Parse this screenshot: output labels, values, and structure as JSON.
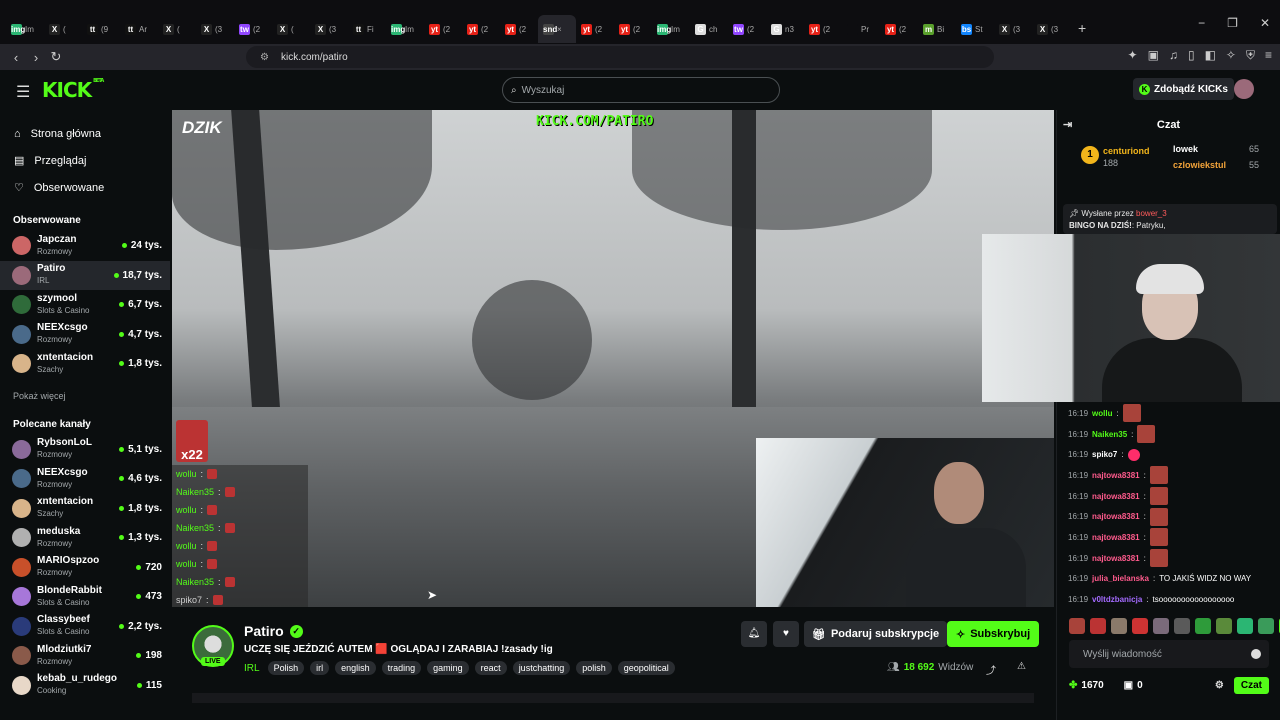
{
  "browser": {
    "tabs": [
      {
        "fav": "img",
        "label": "Im",
        "color": "#2bb673"
      },
      {
        "fav": "X",
        "label": "(",
        "color": "#222"
      },
      {
        "fav": "tt",
        "label": "(9",
        "color": "#111"
      },
      {
        "fav": "tt",
        "label": "Ar",
        "color": "#111"
      },
      {
        "fav": "X",
        "label": "(",
        "color": "#222"
      },
      {
        "fav": "X",
        "label": "(3",
        "color": "#222"
      },
      {
        "fav": "tw",
        "label": "(2",
        "color": "#9146ff"
      },
      {
        "fav": "X",
        "label": "(",
        "color": "#222"
      },
      {
        "fav": "X",
        "label": "(3",
        "color": "#222"
      },
      {
        "fav": "tt",
        "label": "Fi",
        "color": "#111"
      },
      {
        "fav": "img",
        "label": "Im",
        "color": "#2bb673"
      },
      {
        "fav": "yt",
        "label": "(2",
        "color": "#e62117"
      },
      {
        "fav": "yt",
        "label": "(2",
        "color": "#e62117"
      },
      {
        "fav": "yt",
        "label": "(2",
        "color": "#e62117"
      },
      {
        "fav": "snd",
        "label": "×",
        "color": "#444"
      },
      {
        "fav": "yt",
        "label": "(2",
        "color": "#e62117"
      },
      {
        "fav": "yt",
        "label": "(2",
        "color": "#e62117"
      },
      {
        "fav": "img",
        "label": "Im",
        "color": "#2bb673"
      },
      {
        "fav": "G",
        "label": "ch",
        "color": "#ddd"
      },
      {
        "fav": "tw",
        "label": "(2",
        "color": "#9146ff"
      },
      {
        "fav": "G",
        "label": "n3",
        "color": "#ddd"
      },
      {
        "fav": "yt",
        "label": "(2",
        "color": "#e62117"
      },
      {
        "fav": "",
        "label": "Pr",
        "color": "#0d0d10"
      },
      {
        "fav": "yt",
        "label": "(2",
        "color": "#e62117"
      },
      {
        "fav": "m",
        "label": "Bi",
        "color": "#5aa02c"
      },
      {
        "fav": "bs",
        "label": "St",
        "color": "#1185fe"
      },
      {
        "fav": "X",
        "label": "(3",
        "color": "#222"
      },
      {
        "fav": "X",
        "label": "(3",
        "color": "#222"
      }
    ],
    "url": "kick.com/patiro",
    "new_tab": "+",
    "win_min": "−",
    "win_max": "❐",
    "win_close": "✕"
  },
  "header": {
    "logo": "KICK",
    "logo_badge": "BETA",
    "search_placeholder": "Wyszukaj",
    "get_kicks": "Zdobądź KICKs"
  },
  "sidebar": {
    "nav": [
      {
        "icon": "home-icon",
        "glyph": "⌂",
        "label": "Strona główna"
      },
      {
        "icon": "browse-icon",
        "glyph": "▤",
        "label": "Przeglądaj"
      },
      {
        "icon": "heart-icon",
        "glyph": "♡",
        "label": "Obserwowane"
      }
    ],
    "followed_title": "Obserwowane",
    "followed": [
      {
        "name": "Japczan",
        "cat": "Rozmowy",
        "viewers": "24 tys.",
        "color": "#c66"
      },
      {
        "name": "Patiro",
        "cat": "IRL",
        "viewers": "18,7 tys.",
        "color": "#9b6a7a"
      },
      {
        "name": "szymool",
        "cat": "Slots & Casino",
        "viewers": "6,7 tys.",
        "color": "#2f6b3a"
      },
      {
        "name": "NEEXcsgo",
        "cat": "Rozmowy",
        "viewers": "4,7 tys.",
        "color": "#4a6a8a"
      },
      {
        "name": "xntentacion",
        "cat": "Szachy",
        "viewers": "1,8 tys.",
        "color": "#d8b48a"
      }
    ],
    "show_more": "Pokaż więcej",
    "recommended_title": "Polecane kanały",
    "recommended": [
      {
        "name": "RybsonLoL",
        "cat": "Rozmowy",
        "viewers": "5,1 tys.",
        "color": "#8a6a9a"
      },
      {
        "name": "NEEXcsgo",
        "cat": "Rozmowy",
        "viewers": "4,6 tys.",
        "color": "#4a6a8a"
      },
      {
        "name": "xntentacion",
        "cat": "Szachy",
        "viewers": "1,8 tys.",
        "color": "#d8b48a"
      },
      {
        "name": "meduska",
        "cat": "Rozmowy",
        "viewers": "1,3 tys.",
        "color": "#b0b0b0"
      },
      {
        "name": "MARIOspzoo",
        "cat": "Rozmowy",
        "viewers": "720",
        "color": "#c8502a"
      },
      {
        "name": "BlondeRabbit",
        "cat": "Slots & Casino",
        "viewers": "473",
        "color": "#a777d9"
      },
      {
        "name": "Classybeef",
        "cat": "Slots & Casino",
        "viewers": "2,2 tys.",
        "color": "#2a3b7a"
      },
      {
        "name": "Mlodziutki7",
        "cat": "Rozmowy",
        "viewers": "198",
        "color": "#8a5a4a"
      },
      {
        "name": "kebab_u_rudego",
        "cat": "Cooking",
        "viewers": "115",
        "color": "#e8d8c8"
      }
    ]
  },
  "video": {
    "overlay_brand": "DZIK",
    "watermark": "KICK.COM/PATIRO",
    "combo": "x22",
    "overlay_chat": [
      {
        "user": "wollu",
        "color": "#53fc18"
      },
      {
        "user": "Naiken35",
        "color": "#53fc18"
      },
      {
        "user": "wollu",
        "color": "#53fc18"
      },
      {
        "user": "Naiken35",
        "color": "#53fc18"
      },
      {
        "user": "wollu",
        "color": "#53fc18"
      },
      {
        "user": "wollu",
        "color": "#53fc18"
      },
      {
        "user": "Naiken35",
        "color": "#53fc18"
      },
      {
        "user": "spiko7",
        "color": "#cfcfcf"
      }
    ]
  },
  "stream": {
    "name": "Patiro",
    "live": "LIVE",
    "title": "UCZĘ SIĘ JEŹDZIĆ AUTEM 🟥 OGLĄDAJ I ZARABIAJ !zasady !ig",
    "category": "IRL",
    "tags": [
      "Polish",
      "irl",
      "english",
      "trading",
      "gaming",
      "react",
      "justchatting",
      "polish",
      "geopolitical"
    ],
    "gift_label": "Podaruj subskrypcje",
    "sub_label": "Subskrybuj",
    "viewers_count": "18 692",
    "viewers_label": "Widzów"
  },
  "chat": {
    "title": "Czat",
    "leaderboard": {
      "rank": "1",
      "top_name": "centuriond",
      "top_value": "188",
      "second_name": "lowek",
      "second_value": "65",
      "third_name": "czlowiekstul",
      "third_value": "55"
    },
    "pinned_by": "Wysłane przez",
    "pinned_user": "bower_3",
    "pinned_text": "BINGO NA DZIŚ!",
    "pinned_mention": ": Patryku,",
    "messages": [
      {
        "time": "16:19",
        "user": "wollu",
        "color": "#53fc18",
        "text": ""
      },
      {
        "time": "16:19",
        "user": "Naiken35",
        "color": "#53fc18",
        "text": ""
      },
      {
        "time": "16:19",
        "user": "spiko7",
        "color": "#ffffff",
        "text": ""
      },
      {
        "time": "16:19",
        "user": "najtowa8381",
        "color": "#ff5b8d",
        "text": ""
      },
      {
        "time": "16:19",
        "user": "najtowa8381",
        "color": "#ff5b8d",
        "text": ""
      },
      {
        "time": "16:19",
        "user": "najtowa8381",
        "color": "#ff5b8d",
        "text": ""
      },
      {
        "time": "16:19",
        "user": "najtowa8381",
        "color": "#ff5b8d",
        "text": ""
      },
      {
        "time": "16:19",
        "user": "najtowa8381",
        "color": "#ff5b8d",
        "text": ""
      },
      {
        "time": "16:19",
        "user": "julia_bielanska",
        "color": "#ff5b8d",
        "text": "TO JAKIŚ WIDZ NO WAY"
      },
      {
        "time": "16:19",
        "user": "v0ltdzbanicja",
        "color": "#a46bff",
        "text": "tsooooooooooooooooo"
      }
    ],
    "input_placeholder": "Wyślij wiadomość",
    "points": "1670",
    "kicks": "0",
    "send_label": "Czat"
  }
}
